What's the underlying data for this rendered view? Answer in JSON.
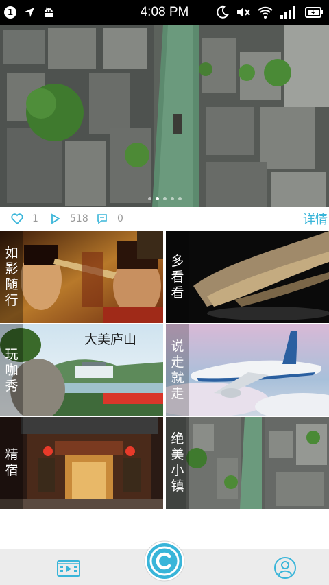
{
  "status_bar": {
    "notification_count": "1",
    "time": "4:08 PM",
    "icons": [
      "notification-badge-icon",
      "navigation-arrow-icon",
      "android-icon",
      "moon-icon",
      "mute-icon",
      "wifi-icon",
      "signal-icon",
      "battery-icon"
    ]
  },
  "hero": {
    "description_icon": "aerial-canal-town-photo",
    "slides": 5,
    "active_slide": 1
  },
  "stats": {
    "likes": "1",
    "plays": "518",
    "comments": "0",
    "detail_label": "详情"
  },
  "tiles": [
    {
      "label": [
        "如",
        "影",
        "随",
        "行"
      ],
      "image": "film-poster-photo"
    },
    {
      "label": [
        "多",
        "看",
        "看"
      ],
      "image": "driftwood-photo"
    },
    {
      "label": [
        "玩",
        "咖",
        "秀"
      ],
      "image": "lushan-landscape-photo"
    },
    {
      "label": [
        "说",
        "走",
        "就",
        "走"
      ],
      "image": "airplane-photo"
    },
    {
      "label": [
        "精",
        "宿"
      ],
      "image": "hotel-entrance-photo"
    },
    {
      "label": [
        "绝",
        "美",
        "小",
        "镇"
      ],
      "image": "canal-town-photo"
    }
  ],
  "tile_texts": {
    "lushan_caption": "大美庐山"
  },
  "bottom_nav": {
    "items": [
      "video-folder-icon",
      "copyright-logo-icon",
      "user-profile-icon"
    ],
    "accent_color": "#39b5d9"
  }
}
